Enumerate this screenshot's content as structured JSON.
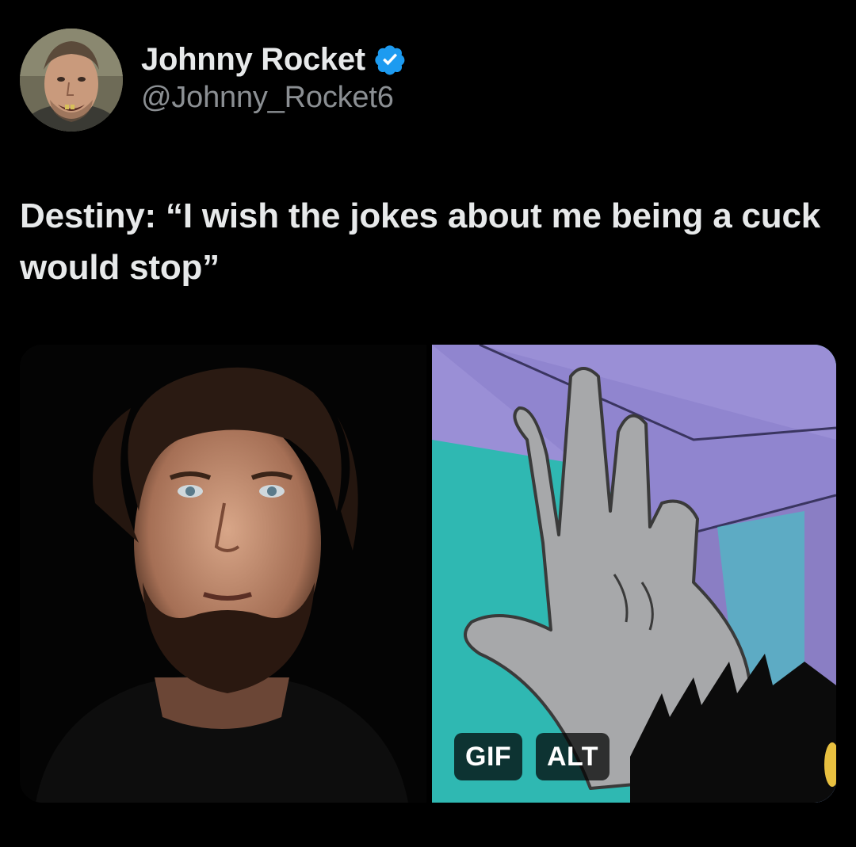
{
  "author": {
    "display_name": "Johnny Rocket",
    "handle": "@Johnny_Rocket6",
    "verified_icon": "verified-badge-icon",
    "verified_color": "#1d9bf0"
  },
  "tweet": {
    "text": "Destiny: “I wish the jokes about me being a cuck would stop”"
  },
  "media": {
    "gif_label": "GIF",
    "alt_label": "ALT"
  },
  "colors": {
    "background": "#000000",
    "text": "#e7e9ea",
    "secondary_text": "#8b8f93"
  }
}
